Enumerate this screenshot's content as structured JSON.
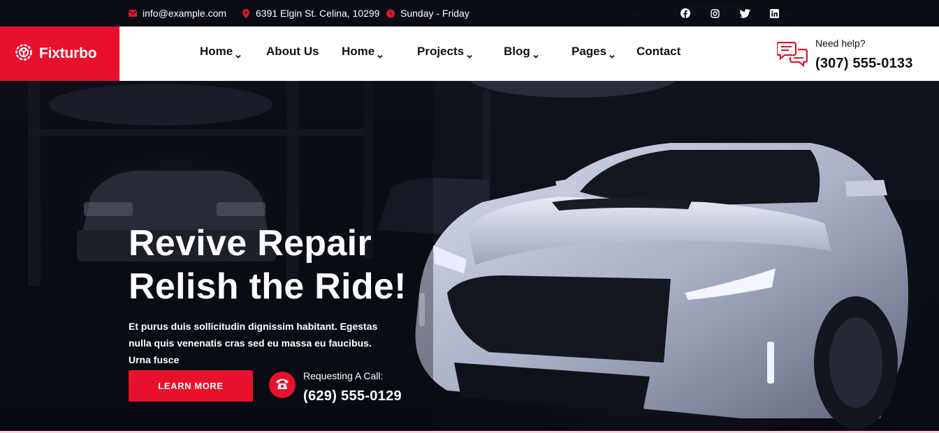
{
  "topbar": {
    "email": "info@example.com",
    "address": "6391 Elgin St. Celina, 10299",
    "hours": "Sunday - Friday",
    "social": [
      "facebook-icon",
      "instagram-icon",
      "twitter-icon",
      "linkedin-icon"
    ]
  },
  "brand": {
    "name": "Fixturbo",
    "accent": "#e8112d"
  },
  "nav": {
    "items": [
      {
        "label": "Home",
        "dropdown": true
      },
      {
        "label": "About Us",
        "dropdown": false
      },
      {
        "label": "Home",
        "dropdown": true
      },
      {
        "label": "Projects",
        "dropdown": true
      },
      {
        "label": "Blog",
        "dropdown": true
      },
      {
        "label": "Pages",
        "dropdown": true
      },
      {
        "label": "Contact",
        "dropdown": false
      }
    ]
  },
  "help": {
    "label": "Need help?",
    "phone": "(307) 555-0133"
  },
  "hero": {
    "headline_line1": "Revive Repair",
    "headline_line2": "Relish the Ride!",
    "subtext": "Et purus duis sollicitudin dignissim habitant. Egestas nulla quis venenatis cras sed eu massa eu faucibus. Urna fusce",
    "button_label": "LEARN MORE",
    "call_label": "Requesting A Call:",
    "call_phone": "(629) 555-0129"
  }
}
